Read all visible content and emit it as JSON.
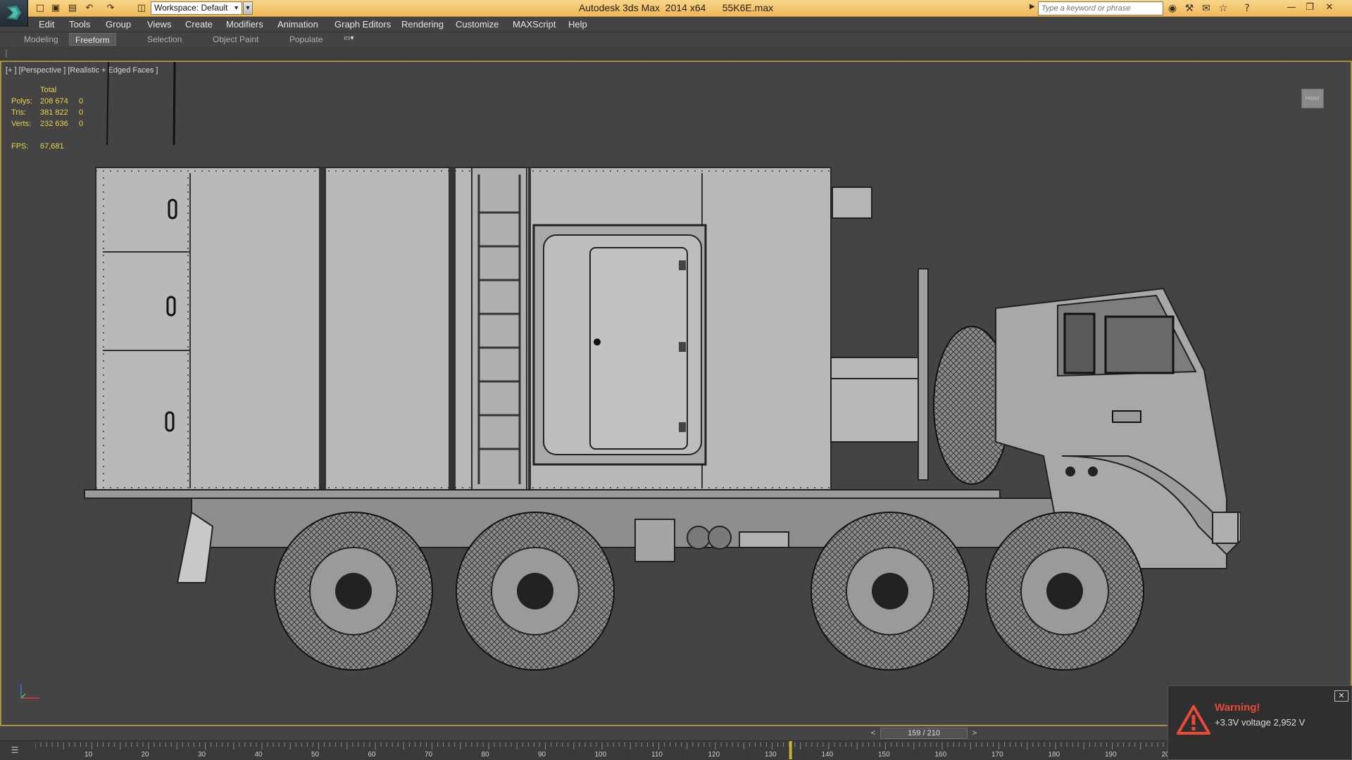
{
  "titlebar": {
    "app_title": "Autodesk 3ds Max  2014 x64      55K6E.max",
    "workspace_label": "Workspace: Default",
    "search_placeholder": "Type a keyword or phrase",
    "icons": [
      "new-file-icon",
      "open-file-icon",
      "save-icon",
      "undo-icon",
      "redo-icon",
      "project-folder-icon",
      "binoculars-icon",
      "wrench-icon",
      "communication-icon",
      "favorites-star-icon",
      "help-icon",
      "minimize-icon",
      "restore-icon",
      "close-icon"
    ]
  },
  "menu": {
    "items": [
      "Edit",
      "Tools",
      "Group",
      "Views",
      "Create",
      "Modifiers",
      "Animation",
      "Graph Editors",
      "Rendering",
      "Customize",
      "MAXScript",
      "Help"
    ]
  },
  "ribbon": {
    "tabs": [
      "Modeling",
      "Freeform",
      "Selection",
      "Object Paint",
      "Populate"
    ],
    "active_tab": "Freeform"
  },
  "viewport": {
    "label": "[+ ] [Perspective ] [Realistic + Edged Faces ]",
    "viewcube_label": "FRONT",
    "stats": {
      "header": "Total",
      "rows": [
        {
          "label": "Polys:",
          "total": "208 674",
          "sel": "0"
        },
        {
          "label": "Tris:",
          "total": "381 822",
          "sel": "0"
        },
        {
          "label": "Verts:",
          "total": "232 636",
          "sel": "0"
        }
      ],
      "fps_label": "FPS:",
      "fps_value": "67,681"
    },
    "border_color": "#a89240",
    "stats_color": "#e8d24a"
  },
  "timeline": {
    "frame_display": "159 / 210",
    "prev_label": "<",
    "next_label": ">",
    "current_frame": 159,
    "total_frames": 210,
    "tick_labels": [
      "10",
      "20",
      "30",
      "40",
      "50",
      "60",
      "70",
      "80",
      "90",
      "100",
      "110",
      "120",
      "130",
      "140",
      "150",
      "160",
      "170",
      "180",
      "190",
      "20"
    ]
  },
  "warning": {
    "title": "Warning!",
    "message": "+3.3V voltage 2,952 V",
    "title_color": "#e84a3a"
  }
}
